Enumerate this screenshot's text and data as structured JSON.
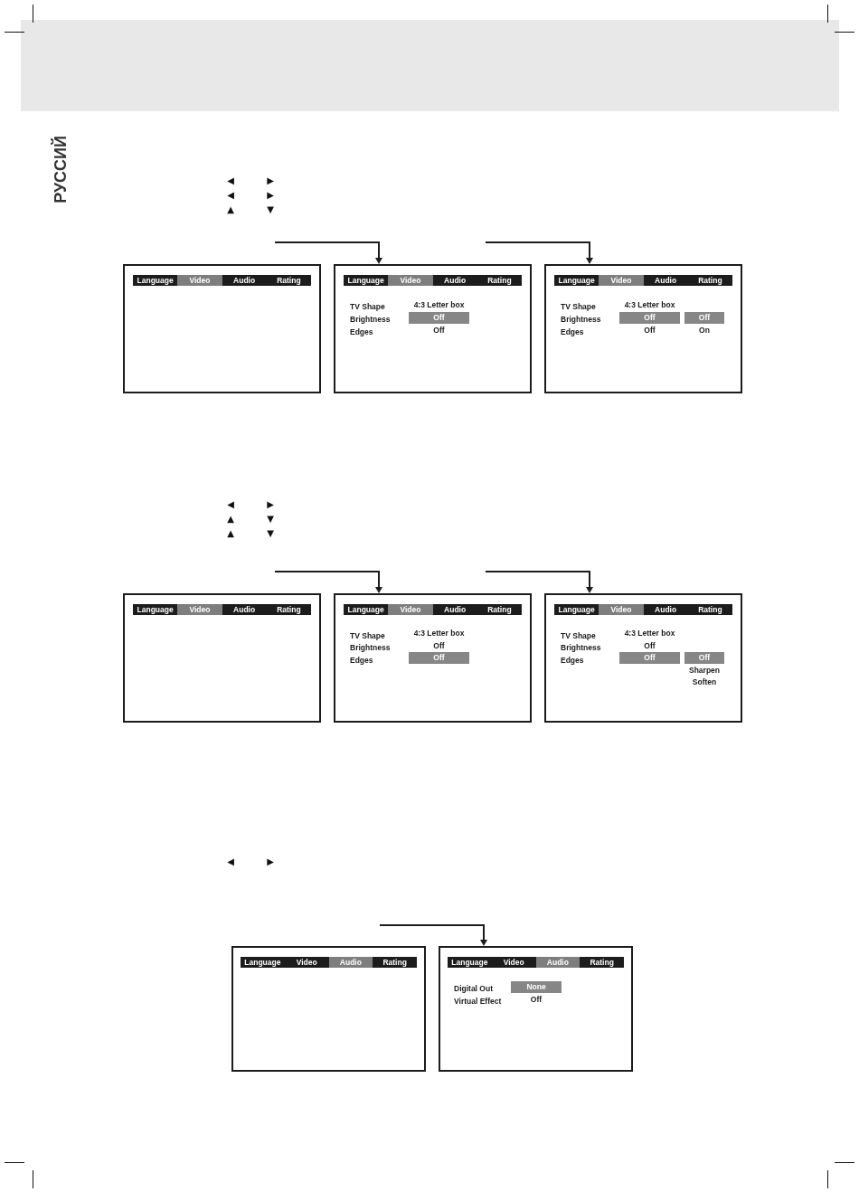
{
  "side_label": "РУССИЙ",
  "sections": [
    {
      "keys": [
        [
          "◀",
          "▶"
        ],
        [
          "◀",
          "▶"
        ],
        [
          "▲",
          "▼"
        ]
      ],
      "screens": [
        {
          "tabs": [
            {
              "label": "Language",
              "selected": false
            },
            {
              "label": "Video",
              "selected": true
            },
            {
              "label": "Audio",
              "selected": false
            },
            {
              "label": "Rating",
              "selected": false
            }
          ]
        },
        {
          "tabs": [
            {
              "label": "Language",
              "selected": false
            },
            {
              "label": "Video",
              "selected": true
            },
            {
              "label": "Audio",
              "selected": false
            },
            {
              "label": "Rating",
              "selected": false
            }
          ],
          "rows": [
            {
              "label": "TV Shape",
              "value": {
                "text": "4:3 Letter box",
                "selected": false
              }
            },
            {
              "label": "Brightness",
              "value": {
                "text": "Off",
                "selected": true
              }
            },
            {
              "label": "Edges",
              "value": {
                "text": "Off",
                "selected": false
              }
            }
          ]
        },
        {
          "tabs": [
            {
              "label": "Language",
              "selected": false
            },
            {
              "label": "Video",
              "selected": true
            },
            {
              "label": "Audio",
              "selected": false
            },
            {
              "label": "Rating",
              "selected": false
            }
          ],
          "rows": [
            {
              "label": "TV Shape",
              "value": {
                "text": "4:3 Letter box",
                "selected": false
              }
            },
            {
              "label": "Brightness",
              "value": {
                "text": "Off",
                "selected": true
              },
              "option": {
                "text": "Off",
                "selected": true
              }
            },
            {
              "label": "Edges",
              "value": {
                "text": "Off",
                "selected": false
              },
              "option": {
                "text": "On",
                "selected": false
              }
            }
          ]
        }
      ]
    },
    {
      "keys": [
        [
          "◀",
          "▶"
        ],
        [
          "▲",
          "▼"
        ],
        [
          "▲",
          "▼"
        ]
      ],
      "screens": [
        {
          "tabs": [
            {
              "label": "Language",
              "selected": false
            },
            {
              "label": "Video",
              "selected": true
            },
            {
              "label": "Audio",
              "selected": false
            },
            {
              "label": "Rating",
              "selected": false
            }
          ]
        },
        {
          "tabs": [
            {
              "label": "Language",
              "selected": false
            },
            {
              "label": "Video",
              "selected": true
            },
            {
              "label": "Audio",
              "selected": false
            },
            {
              "label": "Rating",
              "selected": false
            }
          ],
          "rows": [
            {
              "label": "TV Shape",
              "value": {
                "text": "4:3 Letter box",
                "selected": false
              }
            },
            {
              "label": "Brightness",
              "value": {
                "text": "Off",
                "selected": false
              }
            },
            {
              "label": "Edges",
              "value": {
                "text": "Off",
                "selected": true
              }
            }
          ]
        },
        {
          "tabs": [
            {
              "label": "Language",
              "selected": false
            },
            {
              "label": "Video",
              "selected": true
            },
            {
              "label": "Audio",
              "selected": false
            },
            {
              "label": "Rating",
              "selected": false
            }
          ],
          "rows": [
            {
              "label": "TV Shape",
              "value": {
                "text": "4:3 Letter box",
                "selected": false
              }
            },
            {
              "label": "Brightness",
              "value": {
                "text": "Off",
                "selected": false
              }
            },
            {
              "label": "Edges",
              "value": {
                "text": "Off",
                "selected": true
              },
              "option": {
                "text": "Off",
                "selected": true
              }
            },
            {
              "option": {
                "text": "Sharpen",
                "selected": false
              }
            },
            {
              "option": {
                "text": "Soften",
                "selected": false
              }
            }
          ]
        }
      ]
    },
    {
      "keys": [
        [
          "◀",
          "▶"
        ]
      ],
      "screens": [
        {
          "tabs": [
            {
              "label": "Language",
              "selected": false
            },
            {
              "label": "Video",
              "selected": false
            },
            {
              "label": "Audio",
              "selected": true
            },
            {
              "label": "Rating",
              "selected": false
            }
          ]
        },
        {
          "tabs": [
            {
              "label": "Language",
              "selected": false
            },
            {
              "label": "Video",
              "selected": false
            },
            {
              "label": "Audio",
              "selected": true
            },
            {
              "label": "Rating",
              "selected": false
            }
          ],
          "rows": [
            {
              "label": "Digital Out",
              "value": {
                "text": "None",
                "selected": true
              }
            },
            {
              "label": "Virtual Effect",
              "value": {
                "text": "Off",
                "selected": false
              }
            }
          ]
        }
      ]
    }
  ]
}
